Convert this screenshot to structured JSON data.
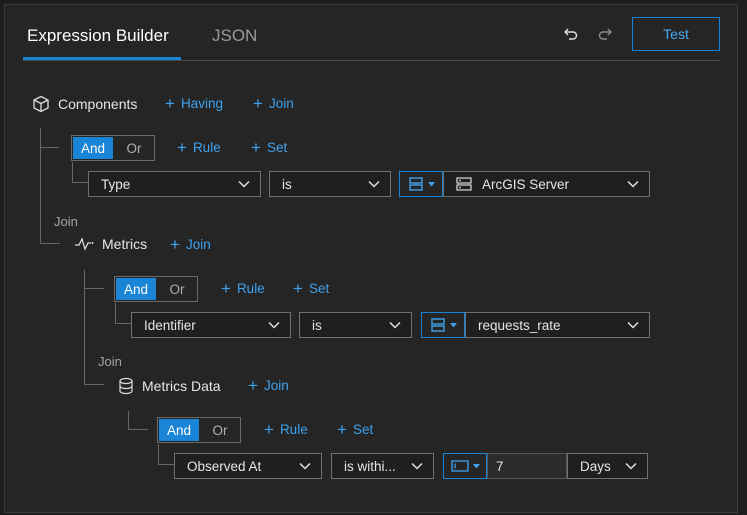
{
  "tabs": {
    "active": "Expression Builder",
    "inactive": "JSON"
  },
  "toolbar": {
    "test_label": "Test"
  },
  "colors": {
    "accent": "#1a84d6",
    "link": "#3fa2ee",
    "background": "#252525"
  },
  "components": {
    "title": "Components",
    "having_label": "Having",
    "join_label": "Join"
  },
  "group1": {
    "and": "And",
    "or": "Or",
    "rule": "Rule",
    "set": "Set",
    "field": "Type",
    "operator": "is",
    "value": "ArcGIS Server"
  },
  "join1": {
    "label": "Join",
    "title": "Metrics",
    "join_label": "Join"
  },
  "group2": {
    "and": "And",
    "or": "Or",
    "rule": "Rule",
    "set": "Set",
    "field": "Identifier",
    "operator": "is",
    "value": "requests_rate"
  },
  "join2": {
    "label": "Join",
    "title": "Metrics Data",
    "join_label": "Join"
  },
  "group3": {
    "and": "And",
    "or": "Or",
    "rule": "Rule",
    "set": "Set",
    "field": "Observed At",
    "operator": "is withi...",
    "number": "7",
    "unit": "Days"
  },
  "icons": [
    "undo-icon",
    "redo-icon",
    "cube-icon",
    "pulse-icon",
    "database-icon",
    "server-icon",
    "chevron-down-icon",
    "source-icon",
    "input-icon"
  ]
}
